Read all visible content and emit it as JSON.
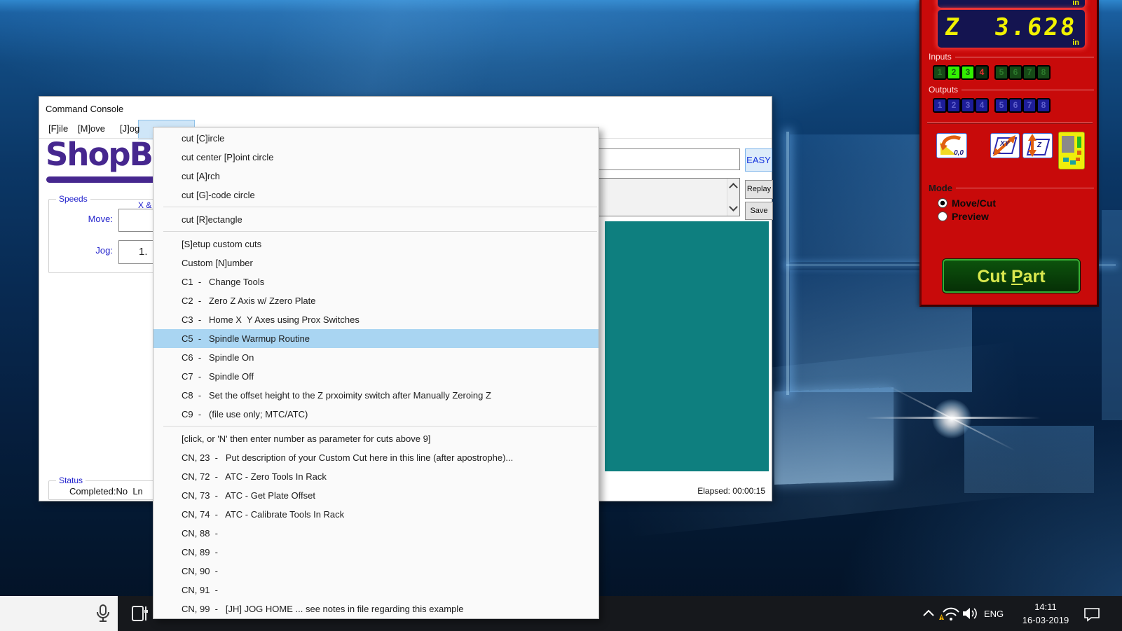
{
  "console_window": {
    "title": "Command Console",
    "menu_bar": {
      "items": [
        "[F]ile",
        "[M]ove",
        "[J]og"
      ]
    },
    "logo_text": "ShopBot",
    "speeds": {
      "legend": "Speeds",
      "column_header": "X &",
      "move_label": "Move:",
      "move_value": "",
      "jog_label": "Jog:",
      "jog_value": "1."
    },
    "command_bar": {
      "input_value": "",
      "easy_button": "EASY",
      "replay_button": "Replay",
      "save_button": "Save"
    },
    "status": {
      "legend": "Status",
      "text": "Completed:No  Ln",
      "elapsed": "Elapsed: 00:00:15"
    }
  },
  "cuts_menu": {
    "items": [
      {
        "label": "cut [C]ircle"
      },
      {
        "label": "cut center [P]oint circle"
      },
      {
        "label": "cut [A]rch"
      },
      {
        "label": "cut [G]-code circle"
      },
      {
        "sep": true
      },
      {
        "label": "cut [R]ectangle"
      },
      {
        "sep": true
      },
      {
        "label": "[S]etup custom cuts"
      },
      {
        "label": "Custom [N]umber"
      },
      {
        "label": "C1  -   Change Tools"
      },
      {
        "label": "C2  -   Zero Z Axis w/ Zzero Plate"
      },
      {
        "label": "C3  -   Home X  Y Axes using Prox Switches"
      },
      {
        "label": "C5  -   Spindle Warmup Routine",
        "highlighted": true
      },
      {
        "label": "C6  -   Spindle On"
      },
      {
        "label": "C7  -   Spindle Off"
      },
      {
        "label": "C8  -   Set the offset height to the Z prxoimity switch after Manually Zeroing Z"
      },
      {
        "label": "C9  -   (file use only; MTC/ATC)"
      },
      {
        "sep": true
      },
      {
        "label": "[click, or 'N' then enter number as parameter for cuts above 9]"
      },
      {
        "label": "CN, 23  -   Put description of your Custom Cut here in this line (after apostrophe)..."
      },
      {
        "label": "CN, 72  -   ATC - Zero Tools In Rack"
      },
      {
        "label": "CN, 73  -   ATC - Get Plate Offset"
      },
      {
        "label": "CN, 74  -   ATC - Calibrate Tools In Rack"
      },
      {
        "label": "CN, 88  -"
      },
      {
        "label": "CN, 89  -"
      },
      {
        "label": "CN, 90  -"
      },
      {
        "label": "CN, 91  -"
      },
      {
        "label": "CN, 99  -   [JH] JOG HOME ... see notes in file regarding this example"
      }
    ]
  },
  "position_panel": {
    "top_display_unit": "in",
    "z_axis": {
      "label": "Z",
      "value": "3.628",
      "unit": "in"
    },
    "inputs": {
      "label": "Inputs",
      "leds": [
        {
          "n": "1",
          "state": "off"
        },
        {
          "n": "2",
          "state": "on"
        },
        {
          "n": "3",
          "state": "on"
        },
        {
          "n": "4",
          "state": "alert"
        },
        {
          "n": "5",
          "state": "off"
        },
        {
          "n": "6",
          "state": "off"
        },
        {
          "n": "7",
          "state": "off"
        },
        {
          "n": "8",
          "state": "off"
        }
      ]
    },
    "outputs": {
      "label": "Outputs",
      "leds": [
        {
          "n": "1",
          "state": "off"
        },
        {
          "n": "2",
          "state": "off"
        },
        {
          "n": "3",
          "state": "off"
        },
        {
          "n": "4",
          "state": "off"
        },
        {
          "n": "5",
          "state": "off"
        },
        {
          "n": "6",
          "state": "off"
        },
        {
          "n": "7",
          "state": "off"
        },
        {
          "n": "8",
          "state": "off"
        }
      ]
    },
    "toolbar": {
      "goto_origin_text": "0,0",
      "xy_text": "XY",
      "z_text": "Z"
    },
    "mode": {
      "legend": "Mode",
      "option1": {
        "label": "Move/Cut",
        "selected": true
      },
      "option2": {
        "label": "Preview",
        "selected": false
      }
    },
    "cut_part": {
      "pre": "Cut ",
      "accel": "P",
      "post": "art"
    },
    "colors": {
      "panel_red": "#c80a0a",
      "display_background": "#141450",
      "digit_yellow": "#f2f200",
      "led_on_green": "#33f000",
      "led_alert_red": "#f03030",
      "output_blue": "#1d1d99",
      "teal_display": "#0e7f7f",
      "cut_part_text": "#d9e84e"
    }
  },
  "taskbar": {
    "tray": {
      "language": "ENG",
      "time": "14:11",
      "date": "16-03-2019"
    }
  }
}
